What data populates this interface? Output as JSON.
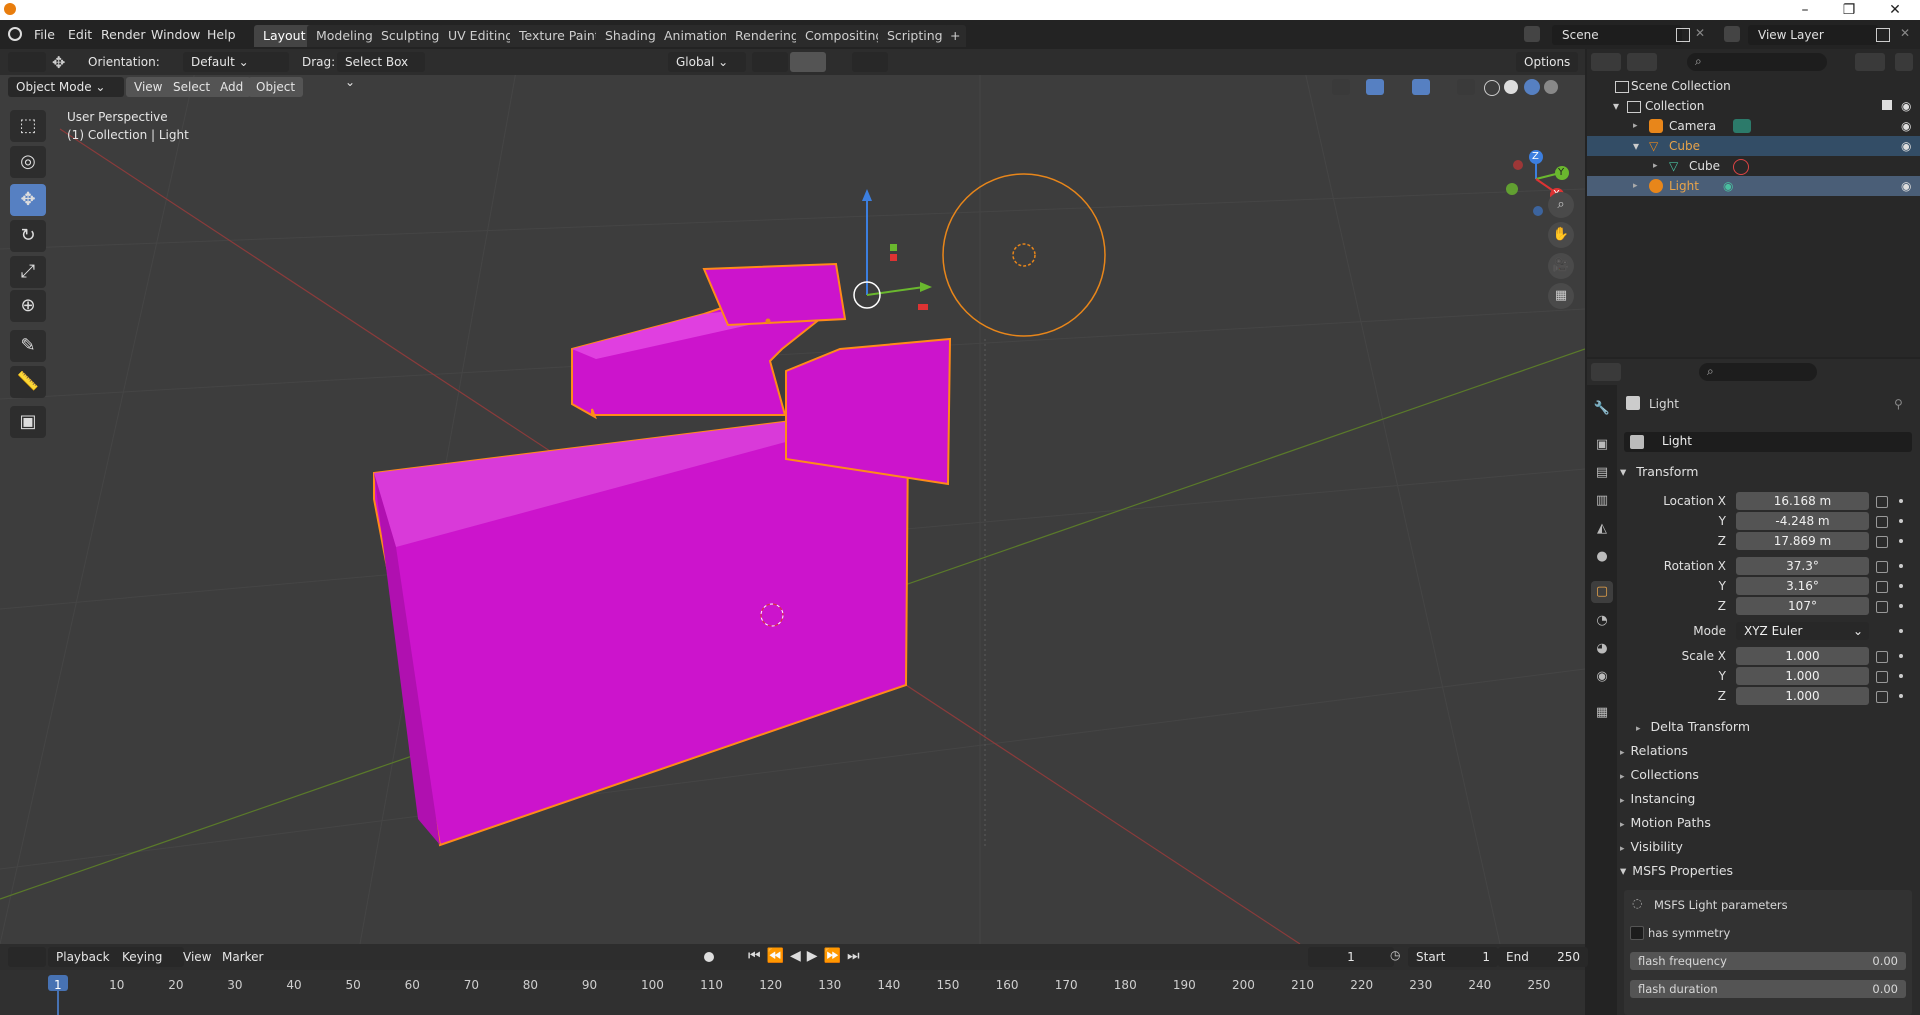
{
  "titlebar": {
    "minimize": "–",
    "restore": "❐",
    "close": "✕"
  },
  "menu": {
    "file": "File",
    "edit": "Edit",
    "render": "Render",
    "window": "Window",
    "help": "Help"
  },
  "workspaces": [
    "Layout",
    "Modeling",
    "Sculpting",
    "UV Editing",
    "Texture Paint",
    "Shading",
    "Animation",
    "Rendering",
    "Compositing",
    "Scripting"
  ],
  "add_workspace": "+",
  "scene": {
    "label": "Scene",
    "view_layer": "View Layer"
  },
  "tool_header": {
    "orientation_label": "Orientation:",
    "orientation_value": "Default",
    "drag_label": "Drag:",
    "drag_value": "Select Box",
    "transform_orientation": "Global",
    "options": "Options"
  },
  "vp_header": {
    "mode": "Object Mode",
    "view": "View",
    "select": "Select",
    "add": "Add",
    "object": "Object"
  },
  "viewport": {
    "perspective": "User Perspective",
    "collection_info": "(1) Collection | Light",
    "axis_x": "X",
    "axis_y": "Y",
    "axis_z": "Z"
  },
  "outliner": {
    "rows": [
      {
        "label": "Scene Collection"
      },
      {
        "label": "Collection"
      },
      {
        "label": "Camera"
      },
      {
        "label": "Cube"
      },
      {
        "label": "Cube"
      },
      {
        "label": "Light"
      }
    ]
  },
  "properties": {
    "object_name": "Light",
    "object_field": "Light",
    "transform": "Transform",
    "location": {
      "label": "Location X",
      "x": "16.168 m",
      "y": "-4.248 m",
      "z": "17.869 m"
    },
    "rotation": {
      "label": "Rotation X",
      "x": "37.3°",
      "y": "3.16°",
      "z": "107°"
    },
    "mode": {
      "label": "Mode",
      "value": "XYZ Euler"
    },
    "scale": {
      "label": "Scale X",
      "x": "1.000",
      "y": "1.000",
      "z": "1.000"
    },
    "axis_y": "Y",
    "axis_z": "Z",
    "delta_transform": "Delta Transform",
    "panels": [
      "Relations",
      "Collections",
      "Instancing",
      "Motion Paths",
      "Visibility",
      "MSFS Properties"
    ],
    "msfs": {
      "title": "MSFS Light parameters",
      "has_symmetry": "has symmetry",
      "flash_frequency": {
        "label": "flash frequency",
        "value": "0.00"
      },
      "flash_duration": {
        "label": "flash duration",
        "value": "0.00"
      }
    }
  },
  "timeline": {
    "playback": "Playback",
    "keying": "Keying",
    "view": "View",
    "marker": "Marker",
    "current_frame": "1",
    "start_label": "Start",
    "start": "1",
    "end_label": "End",
    "end": "250",
    "ticks": [
      "1",
      "10",
      "20",
      "30",
      "40",
      "50",
      "60",
      "70",
      "80",
      "90",
      "100",
      "110",
      "120",
      "130",
      "140",
      "150",
      "160",
      "170",
      "180",
      "190",
      "200",
      "210",
      "220",
      "230",
      "240",
      "250"
    ]
  },
  "colors": {
    "accent": "#5680c2",
    "selection": "#e8861a",
    "mesh": "#cc1acc"
  }
}
